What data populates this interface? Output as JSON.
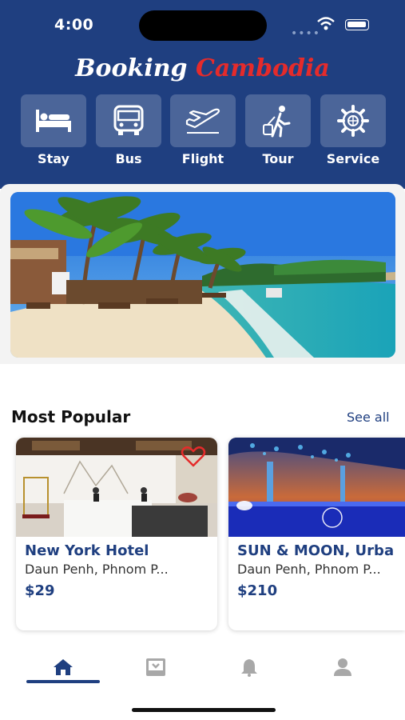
{
  "status_bar": {
    "time": "4:00"
  },
  "header": {
    "brand_first": "Booking",
    "brand_second": "Cambodia",
    "colors": {
      "primary": "#1f3f80",
      "accent": "#e52b2b"
    }
  },
  "categories": [
    {
      "label": "Stay",
      "icon": "bed-icon"
    },
    {
      "label": "Bus",
      "icon": "bus-icon"
    },
    {
      "label": "Flight",
      "icon": "airplane-icon"
    },
    {
      "label": "Tour",
      "icon": "traveler-icon"
    },
    {
      "label": "Service",
      "icon": "gear-icon"
    }
  ],
  "hero": {
    "image": "beach-banner"
  },
  "popular": {
    "title": "Most Popular",
    "see_all": "See all",
    "items": [
      {
        "name": "New York Hotel",
        "location": "Daun Penh, Phnom P...",
        "price": "$29",
        "favorited": true
      },
      {
        "name": "SUN & MOON, Urba",
        "location": "Daun Penh, Phnom P...",
        "price": "$210",
        "favorited": true
      }
    ]
  },
  "tab_bar": {
    "items": [
      {
        "icon": "home-icon",
        "active": true
      },
      {
        "icon": "inbox-icon",
        "active": false
      },
      {
        "icon": "bell-icon",
        "active": false
      },
      {
        "icon": "user-icon",
        "active": false
      }
    ]
  }
}
